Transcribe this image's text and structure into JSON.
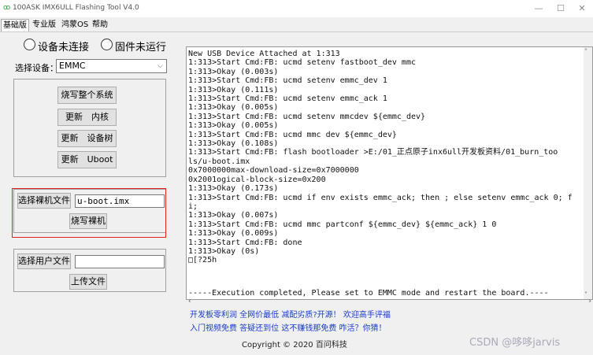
{
  "window": {
    "title": "100ASK IMX6ULL Flashing Tool V4.0",
    "icon": "app-logo-icon",
    "controls": [
      "minimize-icon",
      "maximize-icon",
      "close-icon"
    ]
  },
  "tabs": [
    {
      "label": "基础版",
      "active": true
    },
    {
      "label": "专业版",
      "active": false
    },
    {
      "label": "鸿蒙OS",
      "active": false
    },
    {
      "label": "帮助",
      "active": false
    }
  ],
  "status": {
    "device": "设备未连接",
    "firmware": "固件未运行"
  },
  "device_select": {
    "label": "选择设备：",
    "value": "EMMC"
  },
  "buttons": {
    "burn_all": "烧写整个系统",
    "update_kernel": "更新　内核",
    "update_dtb": "更新　设备树",
    "update_uboot": "更新　Uboot",
    "select_bare_file": "选择裸机文件",
    "burn_bare": "烧写裸机",
    "select_user_file": "选择用户文件",
    "upload_file": "上传文件"
  },
  "bare_file": {
    "value": "u-boot.imx"
  },
  "user_file": {
    "value": ""
  },
  "log": {
    "lines": [
      "New USB Device Attached at 1:313",
      "1:313>Start Cmd:FB: ucmd setenv fastboot_dev mmc",
      "1:313>Okay (0.003s)",
      "1:313>Start Cmd:FB: ucmd setenv emmc_dev 1",
      "1:313>Okay (0.111s)",
      "1:313>Start Cmd:FB: ucmd setenv emmc_ack 1",
      "1:313>Okay (0.005s)",
      "1:313>Start Cmd:FB: ucmd setenv mmcdev ${emmc_dev}",
      "1:313>Okay (0.005s)",
      "1:313>Start Cmd:FB: ucmd mmc dev ${emmc_dev}",
      "1:313>Okay (0.108s)",
      "1:313>Start Cmd:FB: flash bootloader >E:/01_正点原子inx6ull开发板资料/01_burn_too",
      "ls/u-boot.imx",
      "0x7000000max-download-size=0x7000000",
      "0x2001ogical-block-size=0x200",
      "1:313>Okay (0.173s)",
      "1:313>Start Cmd:FB: ucmd if env exists emmc_ack; then ; else setenv emmc_ack 0; f",
      "i;",
      "1:313>Okay (0.007s)",
      "1:313>Start Cmd:FB: ucmd mmc partconf ${emmc_dev} ${emmc_ack} 1 0",
      "1:313>Okay (0.009s)",
      "1:313>Start Cmd:FB: done",
      "1:313>Okay (0s)",
      "□[?25h"
    ],
    "status_line": "-----Execution completed, Please set to EMMC mode and restart the board.----"
  },
  "footer": {
    "link1": "开发板零利润  全网价最低  减配劣质?开源！ 欢迎高手评福",
    "link2": "入门视频免费  答疑还到位  这不赚钱那免费  咋活？你猜！",
    "copyright": "Copyright © 2020 百问科技"
  },
  "watermark": "CSDN @哆哆jarvis",
  "colors": {
    "highlight_box": "#e02020",
    "link": "#1a3cc8",
    "app_icon": "#2e9e3a"
  }
}
